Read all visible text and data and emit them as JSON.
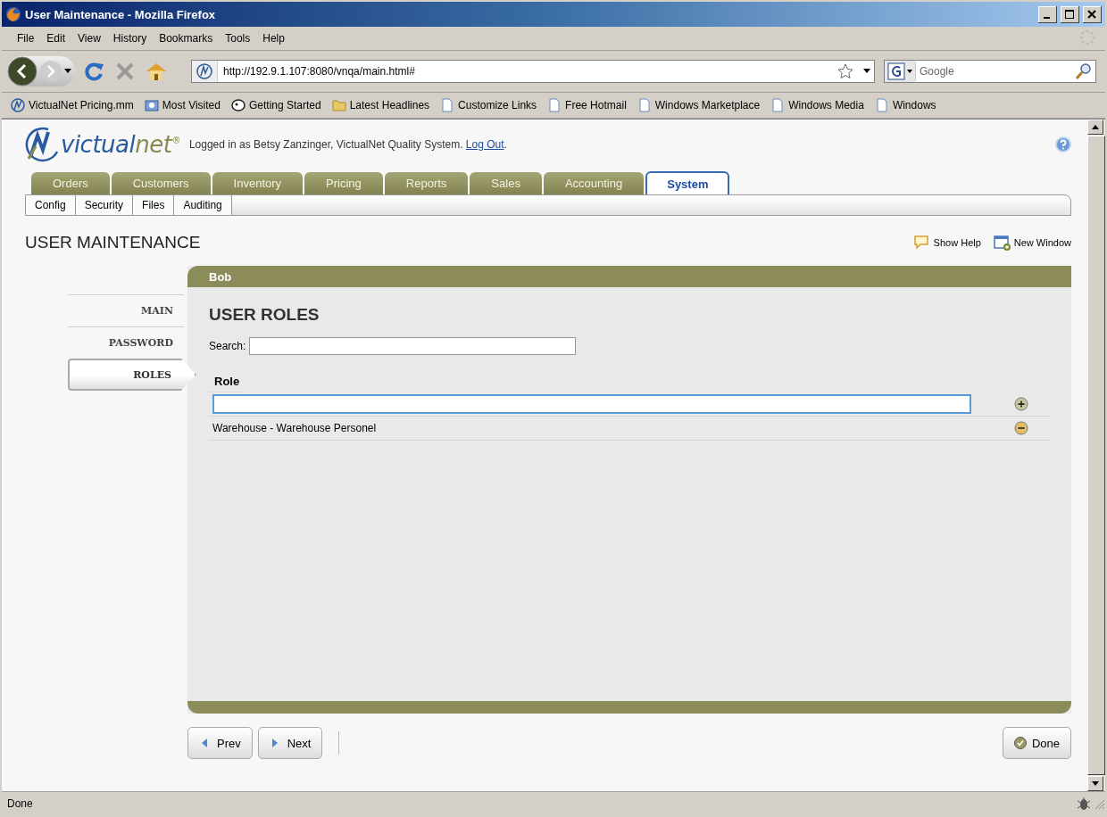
{
  "window": {
    "title": "User Maintenance - Mozilla Firefox"
  },
  "menu": [
    "File",
    "Edit",
    "View",
    "History",
    "Bookmarks",
    "Tools",
    "Help"
  ],
  "toolbar": {
    "url": "http://192.9.1.107:8080/vnqa/main.html#",
    "search_placeholder": "Google"
  },
  "bookmarks": [
    {
      "label": "VictualNet Pricing.mm",
      "kind": "site"
    },
    {
      "label": "Most Visited",
      "kind": "smart"
    },
    {
      "label": "Getting Started",
      "kind": "bug"
    },
    {
      "label": "Latest Headlines",
      "kind": "folder"
    },
    {
      "label": "Customize Links",
      "kind": "page"
    },
    {
      "label": "Free Hotmail",
      "kind": "page"
    },
    {
      "label": "Windows Marketplace",
      "kind": "page"
    },
    {
      "label": "Windows Media",
      "kind": "page"
    },
    {
      "label": "Windows",
      "kind": "page"
    }
  ],
  "app": {
    "logo": [
      "victual",
      "net",
      "®"
    ],
    "login": {
      "text": "Logged in as Betsy Zanzinger, VictualNet Quality System.",
      "link": "Log Out",
      "end": "."
    },
    "tabs": [
      {
        "label": "Orders",
        "selected": false
      },
      {
        "label": "Customers",
        "selected": false
      },
      {
        "label": "Inventory",
        "selected": false
      },
      {
        "label": "Pricing",
        "selected": false
      },
      {
        "label": "Reports",
        "selected": false
      },
      {
        "label": "Sales",
        "selected": false
      },
      {
        "label": "Accounting",
        "selected": false
      },
      {
        "label": "System",
        "selected": true
      }
    ],
    "subtabs": [
      "Config",
      "Security",
      "Files",
      "Auditing"
    ],
    "page_title": "USER MAINTENANCE",
    "actions": [
      {
        "label": "Show Help",
        "kind": "help"
      },
      {
        "label": "New Window",
        "kind": "window"
      }
    ],
    "panel_title": "Bob",
    "side_nav": [
      {
        "label": "MAIN",
        "selected": false
      },
      {
        "label": "PASSWORD",
        "selected": false
      },
      {
        "label": "ROLES",
        "selected": true
      }
    ],
    "section_title": "USER ROLES",
    "search_label": "Search:",
    "table": {
      "columns": [
        "Role"
      ],
      "rows": [
        {
          "kind": "input"
        },
        {
          "kind": "text",
          "text": "Warehouse - Warehouse Personel"
        }
      ]
    },
    "buttons": [
      {
        "label": "Prev",
        "kind": "prev"
      },
      {
        "label": "Next",
        "kind": "next"
      },
      {
        "label": "Done",
        "kind": "done"
      }
    ]
  },
  "status_bar": "Done"
}
